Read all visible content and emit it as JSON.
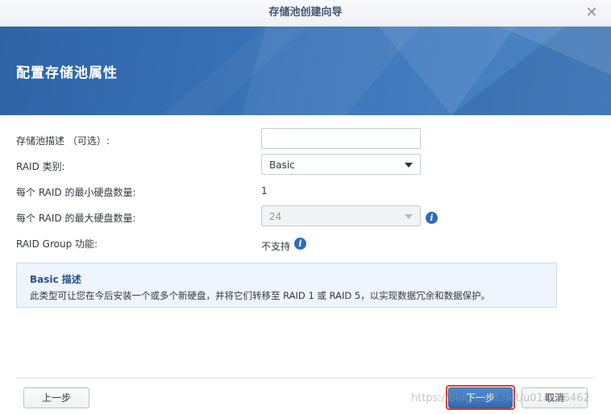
{
  "window": {
    "title": "存储池创建向导",
    "close_glyph": "✕"
  },
  "banner": {
    "title": "配置存储池属性"
  },
  "form": {
    "description_label": "存储池描述 （可选）:",
    "description_value": "",
    "raid_type_label": "RAID 类别:",
    "raid_type_value": "Basic",
    "min_disks_label": "每个 RAID 的最小硬盘数量:",
    "min_disks_value": "1",
    "max_disks_label": "每个 RAID 的最大硬盘数量:",
    "max_disks_value": "24",
    "raid_group_label": "RAID Group 功能:",
    "raid_group_value": "不支持"
  },
  "info_box": {
    "title": "Basic 描述",
    "text": "此类型可让您在今后安装一个或多个新硬盘，并将它们转移至 RAID 1 或 RAID 5，以实现数据冗余和数据保护。"
  },
  "footer": {
    "back_label": "上一步",
    "next_label": "下一步",
    "cancel_label": "取消",
    "watermark": "https://blog.csdn.net/u014156462"
  },
  "icons": {
    "info": "i"
  },
  "colors": {
    "accent": "#2f6bbd",
    "highlight": "#e53b2f",
    "banner": "#3a73b8"
  }
}
